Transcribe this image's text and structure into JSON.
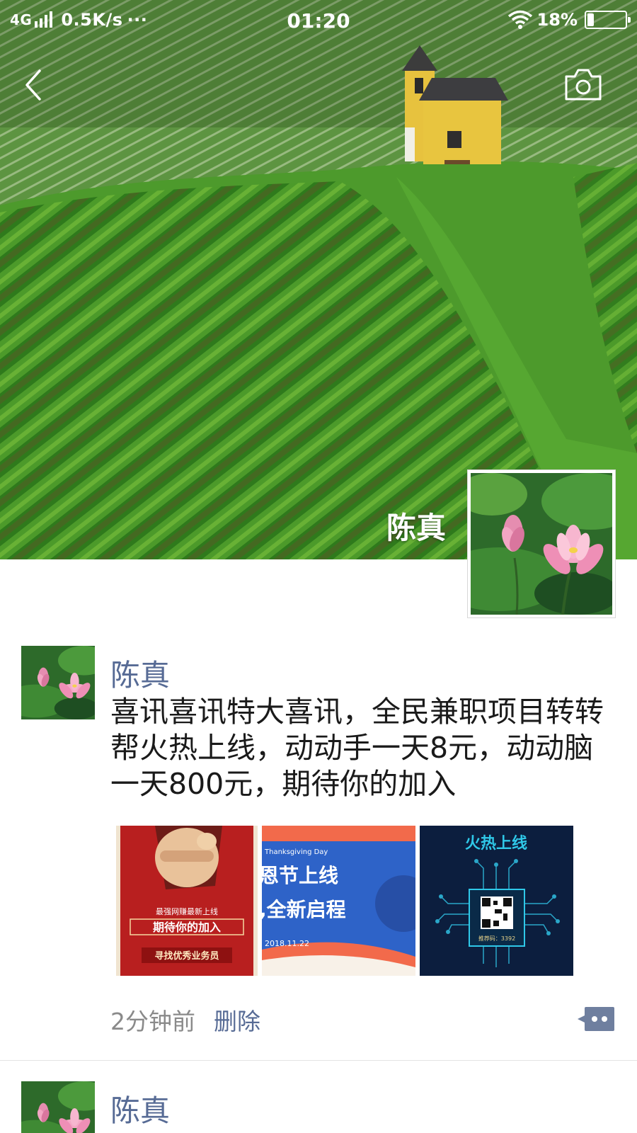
{
  "status_bar": {
    "network": "4G",
    "speed": "0.5K/s",
    "dots": "···",
    "time": "01:20",
    "battery": "18%",
    "battery_level": 0.18
  },
  "nav": {
    "back_icon": "chevron-left-icon",
    "camera_icon": "camera-icon"
  },
  "profile": {
    "name": "陈真"
  },
  "posts": [
    {
      "author": "陈真",
      "text": "喜讯喜讯特大喜讯，全民兼职项目转转帮火热上线，动动手一天8元，动动脑一天800元，期待你的加入",
      "images": [
        {
          "lines": [
            "最强网赚最新上线",
            "期待你的加入",
            "寻找优秀业务员"
          ]
        },
        {
          "lines": [
            "Thanksgiving Day",
            "恩节上线",
            ",全新启程",
            "2018.11.22"
          ]
        },
        {
          "lines": [
            "火热上线",
            "推荐码：3392"
          ]
        }
      ],
      "time": "2分钟前",
      "delete_label": "删除"
    },
    {
      "author": "陈真"
    }
  ]
}
